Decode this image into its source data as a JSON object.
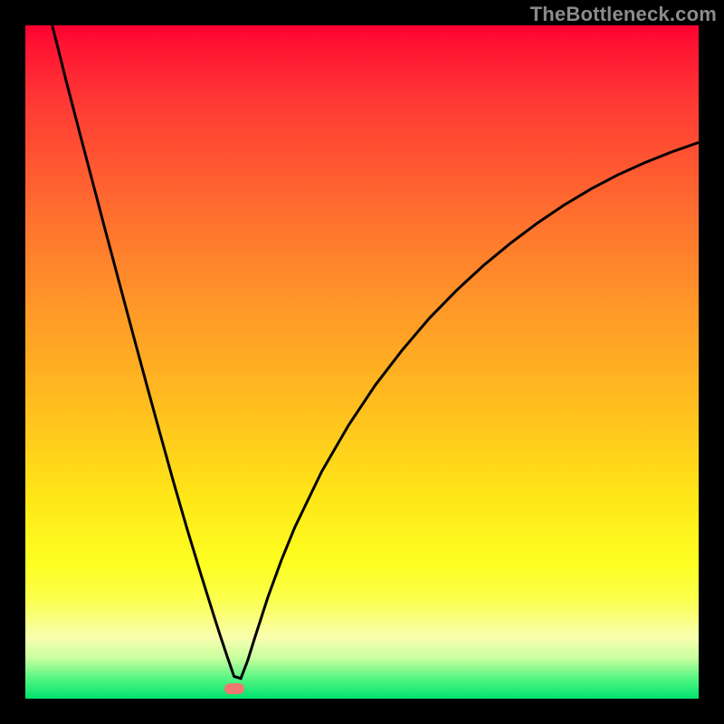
{
  "watermark": "TheBottleneck.com",
  "chart_data": {
    "type": "line",
    "title": "",
    "xlabel": "",
    "ylabel": "",
    "xlim": [
      0,
      100
    ],
    "ylim": [
      0,
      100
    ],
    "minimum_at": {
      "x": 31,
      "y": 1.5
    },
    "series": [
      {
        "name": "curve",
        "x": [
          4,
          6,
          8,
          10,
          12,
          14,
          16,
          18,
          20,
          22,
          24,
          26,
          28,
          29,
          30,
          31,
          32,
          33,
          34,
          36,
          38,
          40,
          44,
          48,
          52,
          56,
          60,
          64,
          68,
          72,
          76,
          80,
          84,
          88,
          92,
          96,
          100
        ],
        "values": [
          100,
          92,
          84.3,
          76.7,
          69.1,
          61.6,
          54.1,
          46.7,
          39.4,
          32.2,
          25.3,
          18.7,
          12.3,
          9.2,
          6.2,
          3.3,
          3.0,
          5.6,
          8.8,
          15.0,
          20.5,
          25.4,
          33.7,
          40.6,
          46.6,
          51.8,
          56.5,
          60.6,
          64.3,
          67.6,
          70.6,
          73.3,
          75.7,
          77.8,
          79.6,
          81.2,
          82.6
        ]
      }
    ]
  },
  "colors": {
    "curve": "#000000",
    "min_dot": "#f07870",
    "background_frame": "#000000"
  }
}
